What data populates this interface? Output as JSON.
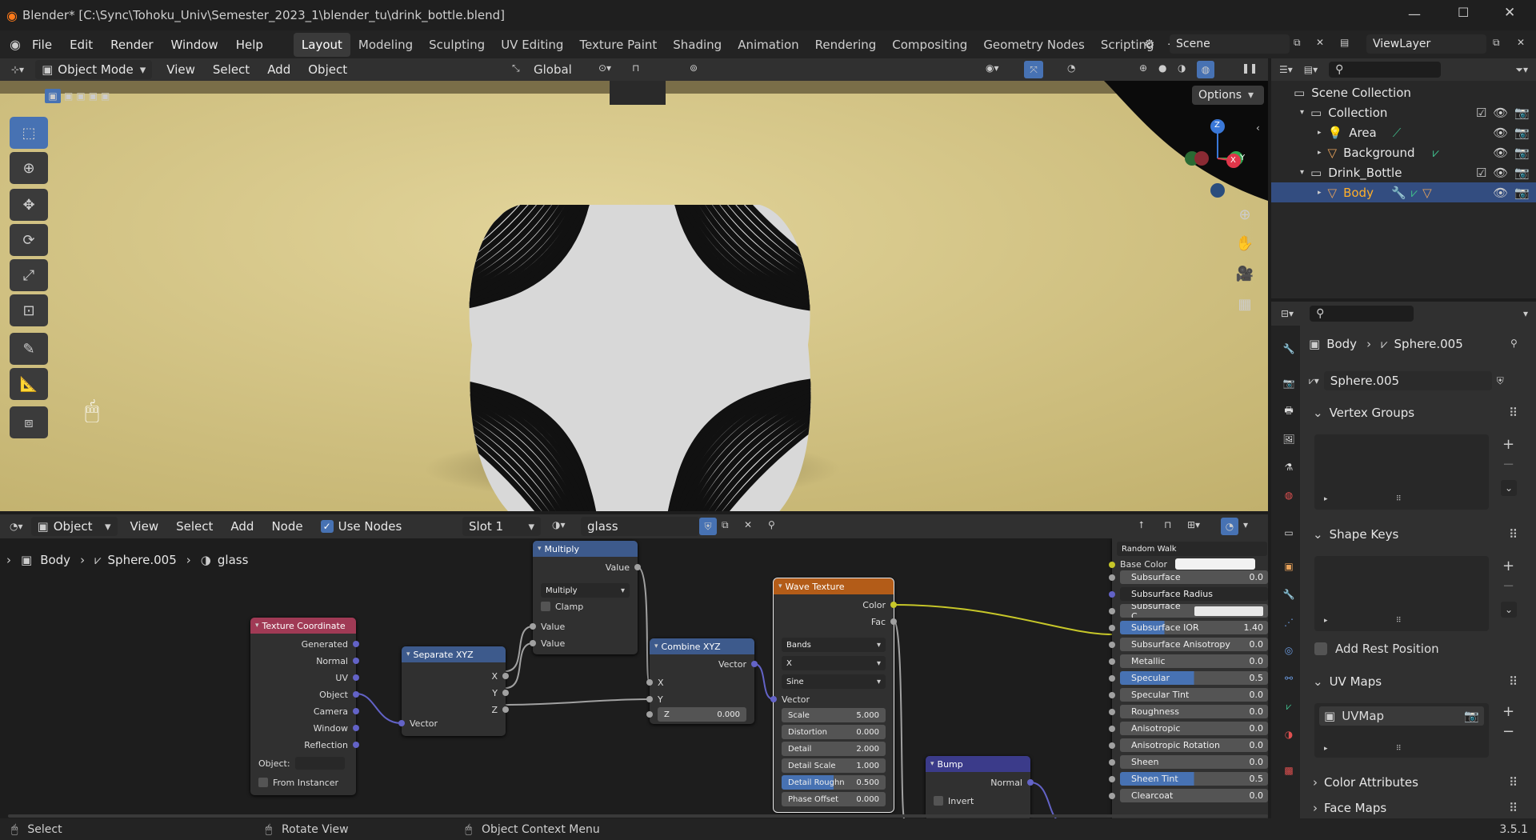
{
  "title_bar": {
    "title": "Blender* [C:\\Sync\\Tohoku_Univ\\Semester_2023_1\\blender_tu\\drink_bottle.blend]"
  },
  "menu": [
    "File",
    "Edit",
    "Render",
    "Window",
    "Help"
  ],
  "workspaces": [
    "Layout",
    "Modeling",
    "Sculpting",
    "UV Editing",
    "Texture Paint",
    "Shading",
    "Animation",
    "Rendering",
    "Compositing",
    "Geometry Nodes",
    "Scripting"
  ],
  "active_workspace": "Layout",
  "scene": {
    "name": "Scene",
    "view_layer": "ViewLayer"
  },
  "viewport": {
    "mode": "Object Mode",
    "menus": [
      "View",
      "Select",
      "Add",
      "Object"
    ],
    "orientation": "Global",
    "options_label": "Options",
    "gizmo": {
      "z": "Z",
      "x": "X",
      "y": "Y"
    }
  },
  "outliner": {
    "items": [
      {
        "label": "Scene Collection",
        "depth": 0
      },
      {
        "label": "Collection",
        "depth": 1
      },
      {
        "label": "Area",
        "depth": 2
      },
      {
        "label": "Background",
        "depth": 2
      },
      {
        "label": "Drink_Bottle",
        "depth": 1
      },
      {
        "label": "Body",
        "depth": 2
      }
    ]
  },
  "node_editor": {
    "editor_type": "Object",
    "menus": [
      "View",
      "Select",
      "Add",
      "Node"
    ],
    "use_nodes_label": "Use Nodes",
    "slot": "Slot 1",
    "material": "glass",
    "breadcrumb": [
      "Body",
      "Sphere.005",
      "glass"
    ]
  },
  "nodes": {
    "texcoord": {
      "title": "Texture Coordinate",
      "outputs": [
        "Generated",
        "Normal",
        "UV",
        "Object",
        "Camera",
        "Window",
        "Reflection"
      ],
      "object_label": "Object:",
      "from_instancer": "From Instancer"
    },
    "separate": {
      "title": "Separate XYZ",
      "outputs": [
        "X",
        "Y",
        "Z"
      ],
      "input": "Vector"
    },
    "multiply": {
      "title": "Multiply",
      "output": "Value",
      "operation": "Multiply",
      "clamp": "Clamp",
      "inputs": [
        "Value",
        "Value"
      ]
    },
    "combine": {
      "title": "Combine XYZ",
      "output": "Vector",
      "inputs": [
        "X",
        "Y"
      ],
      "z_label": "Z",
      "z_value": "0.000"
    },
    "wave": {
      "title": "Wave Texture",
      "outputs": [
        "Color",
        "Fac"
      ],
      "type": "Bands",
      "direction": "X",
      "profile": "Sine",
      "vector": "Vector",
      "fields": [
        {
          "label": "Scale",
          "value": "5.000"
        },
        {
          "label": "Distortion",
          "value": "0.000"
        },
        {
          "label": "Detail",
          "value": "2.000"
        },
        {
          "label": "Detail Scale",
          "value": "1.000"
        },
        {
          "label": "Detail Roughn",
          "value": "0.500"
        },
        {
          "label": "Phase Offset",
          "value": "0.000"
        }
      ]
    },
    "bump": {
      "title": "Bump",
      "output": "Normal",
      "invert": "Invert"
    },
    "bsdf": {
      "subsurface_method": "Random Walk",
      "base_color": "Base Color",
      "rows": [
        {
          "label": "Subsurface",
          "value": "0.0",
          "fill": 0
        },
        {
          "label": "Subsurface Radius",
          "value": "",
          "fill": 0
        },
        {
          "label": "Subsurface C...",
          "value": "",
          "fill": 0
        },
        {
          "label": "Subsurface IOR",
          "value": "1.40",
          "fill": 0.3
        },
        {
          "label": "Subsurface Anisotropy",
          "value": "0.0",
          "fill": 0
        },
        {
          "label": "Metallic",
          "value": "0.0",
          "fill": 0
        },
        {
          "label": "Specular",
          "value": "0.5",
          "fill": 0.5
        },
        {
          "label": "Specular Tint",
          "value": "0.0",
          "fill": 0
        },
        {
          "label": "Roughness",
          "value": "0.0",
          "fill": 0
        },
        {
          "label": "Anisotropic",
          "value": "0.0",
          "fill": 0
        },
        {
          "label": "Anisotropic Rotation",
          "value": "0.0",
          "fill": 0
        },
        {
          "label": "Sheen",
          "value": "0.0",
          "fill": 0
        },
        {
          "label": "Sheen Tint",
          "value": "0.5",
          "fill": 0.5
        },
        {
          "label": "Clearcoat",
          "value": "0.0",
          "fill": 0
        }
      ]
    }
  },
  "properties": {
    "breadcrumb": [
      "Body",
      "Sphere.005"
    ],
    "mesh_name": "Sphere.005",
    "sections": {
      "vertex_groups": "Vertex Groups",
      "shape_keys": "Shape Keys",
      "add_rest_position": "Add Rest Position",
      "uv_maps": "UV Maps",
      "uv_map_item": "UVMap",
      "color_attributes": "Color Attributes",
      "face_maps": "Face Maps"
    }
  },
  "status_bar": {
    "select": "Select",
    "rotate": "Rotate View",
    "context_menu": "Object Context Menu",
    "version": "3.5.1"
  },
  "colors": {
    "accent": "#4772b3",
    "texcoord_header": "#a03a55",
    "vector_header": "#3d5a8c",
    "texture_header": "#b35c18",
    "bump_header": "#3b3b8a"
  }
}
